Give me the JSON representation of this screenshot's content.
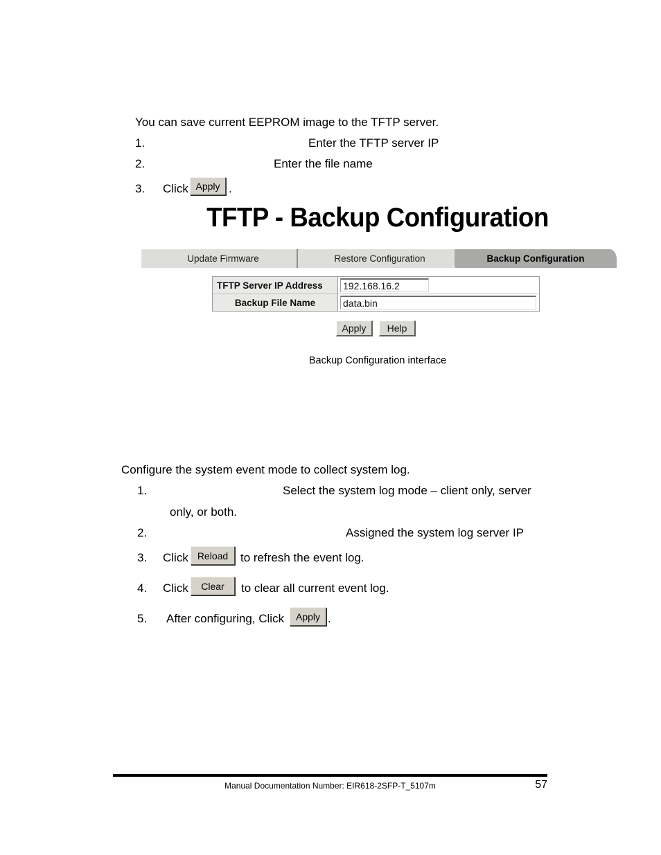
{
  "document": {
    "backup_section": {
      "intro": "You can save current EEPROM image to the TFTP server.",
      "steps": [
        {
          "number": "1.",
          "text": "Enter the TFTP server IP"
        },
        {
          "number": "2.",
          "text": "Enter the file name"
        },
        {
          "number": "3.",
          "prefix": "Click",
          "button": "Apply",
          "suffix": "."
        }
      ]
    },
    "screenshot": {
      "title": "TFTP - Backup Configuration",
      "tabs": [
        {
          "label": "Update Firmware",
          "active": false
        },
        {
          "label": "Restore Configuration",
          "active": false
        },
        {
          "label": "Backup Configuration",
          "active": true
        }
      ],
      "form_rows": [
        {
          "label": "TFTP Server IP Address",
          "value": "192.168.16.2"
        },
        {
          "label": "Backup File Name",
          "value": "data.bin"
        }
      ],
      "buttons": [
        {
          "label": "Apply"
        },
        {
          "label": "Help"
        }
      ],
      "caption": "Backup Configuration interface"
    },
    "syslog_section": {
      "intro": "Configure the system event mode to collect system log.",
      "steps": [
        {
          "number": "1.",
          "text": "Select the system log mode – client only, server",
          "text_cont": "only, or both."
        },
        {
          "number": "2.",
          "text": "Assigned the system log server IP"
        },
        {
          "number": "3.",
          "prefix": "Click",
          "button": "Reload",
          "suffix": "to refresh the event log."
        },
        {
          "number": "4.",
          "prefix": "Click",
          "button": "Clear",
          "suffix": "to clear all current event log."
        },
        {
          "number": "5.",
          "prefix": "After configuring, Click",
          "button": "Apply",
          "suffix": "."
        }
      ]
    },
    "footer": {
      "text": "Manual Documentation Number: EIR618-2SFP-T_5107m",
      "page_number": "57"
    }
  },
  "colors": {
    "tab_active_bg": "#a9a9a7",
    "tab_inactive_bg": "#dddddb",
    "form_label_bg": "#e9e9e7",
    "inline_button_bg": "#d5d2ca",
    "window_button_bg": "#d8d8d4",
    "text": "#000000"
  }
}
